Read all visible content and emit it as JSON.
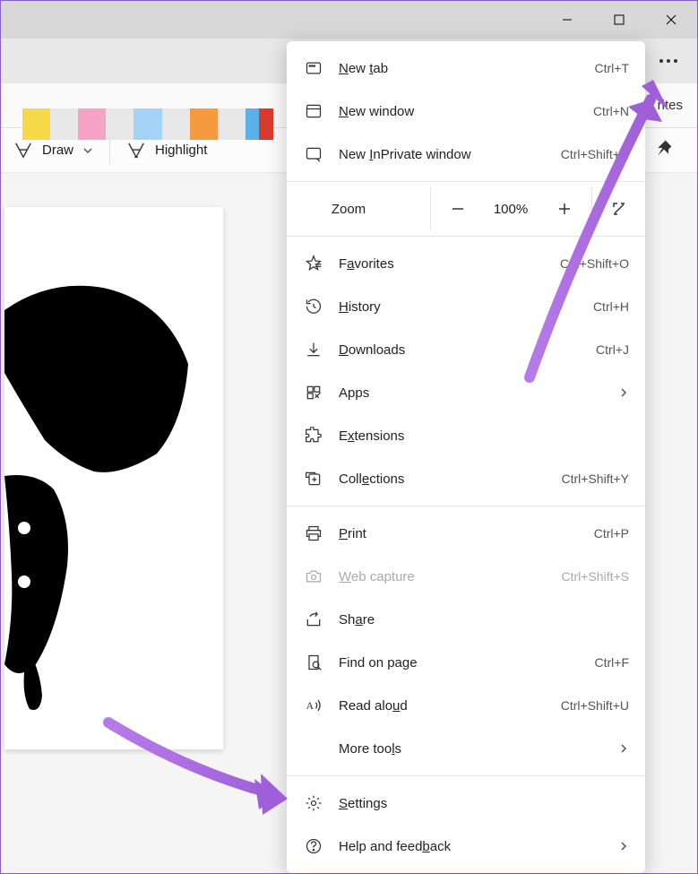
{
  "titlebar": {
    "min": "minimize",
    "max": "maximize",
    "close": "close"
  },
  "more_btn": "⋯",
  "fav_txt": "rites",
  "docbar": {
    "draw": "Draw",
    "highlight": "Highlight"
  },
  "zoom": {
    "label": "Zoom",
    "value": "100%"
  },
  "menu": {
    "newtab": {
      "label": "New tab",
      "sc": "Ctrl+T"
    },
    "newwin": {
      "label": "New window",
      "sc": "Ctrl+N"
    },
    "newpriv": {
      "label": "New InPrivate window",
      "sc": "Ctrl+Shift+N"
    },
    "fav": {
      "label": "Favorites",
      "sc": "Ctrl+Shift+O"
    },
    "hist": {
      "label": "History",
      "sc": "Ctrl+H"
    },
    "dl": {
      "label": "Downloads",
      "sc": "Ctrl+J"
    },
    "apps": {
      "label": "Apps"
    },
    "ext": {
      "label": "Extensions"
    },
    "coll": {
      "label": "Collections",
      "sc": "Ctrl+Shift+Y"
    },
    "print": {
      "label": "Print",
      "sc": "Ctrl+P"
    },
    "webcap": {
      "label": "Web capture",
      "sc": "Ctrl+Shift+S"
    },
    "share": {
      "label": "Share"
    },
    "find": {
      "label": "Find on page",
      "sc": "Ctrl+F"
    },
    "read": {
      "label": "Read aloud",
      "sc": "Ctrl+Shift+U"
    },
    "moretools": {
      "label": "More tools"
    },
    "settings": {
      "label": "Settings"
    },
    "help": {
      "label": "Help and feedback"
    }
  },
  "colors": [
    "#f5d949",
    "#e8e8e8",
    "#f5a3c7",
    "#e8e8e8",
    "#a3d4f5",
    "#e8e8e8",
    "#f59a3e",
    "#e8e8e8",
    "#5bb0e8",
    "#d93a2e"
  ]
}
